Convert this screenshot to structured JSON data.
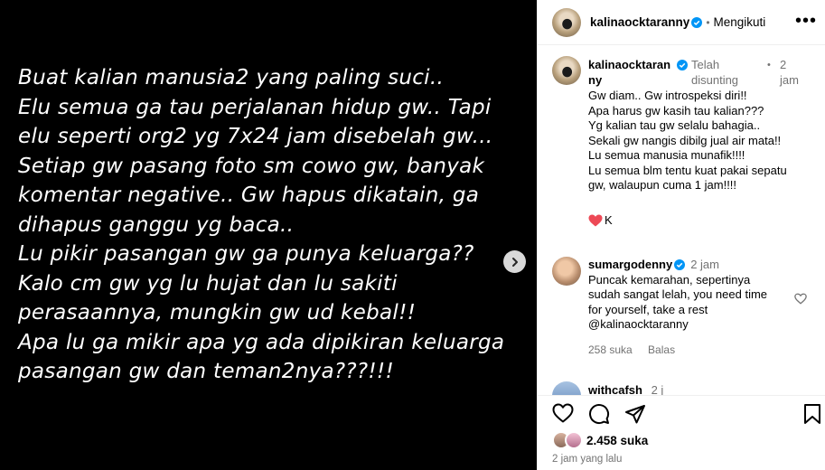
{
  "media": {
    "lines": [
      "Buat kalian manusia2 yang paling suci..",
      "Elu semua ga tau perjalanan hidup gw.. Tapi",
      "elu seperti org2 yg 7x24 jam disebelah gw...",
      "Setiap gw pasang foto sm cowo gw, banyak",
      "komentar negative.. Gw hapus dikatain, ga",
      "dihapus ganggu yg baca..",
      "Lu pikir pasangan gw ga punya keluarga??",
      "Kalo cm gw yg lu hujat dan lu sakiti",
      "perasaannya, mungkin gw ud kebal!!",
      "Apa lu ga mikir apa yg ada dipikiran keluarga",
      "pasangan gw dan teman2nya???!!!"
    ]
  },
  "header": {
    "username": "kalinaocktaranny",
    "separator": "•",
    "follow_label": "Mengikuti",
    "more_icon": "more-icon"
  },
  "caption": {
    "username_line1": "kalinaocktaran",
    "username_line2": "ny",
    "edited_line1": "Telah",
    "edited_line2": "disunting",
    "separator": "•",
    "time_line1": "2",
    "time_line2": "jam",
    "lines": [
      "Gw diam.. Gw introspeksi diri!!",
      "Apa harus gw kasih tau kalian???",
      "Yg kalian tau gw selalu bahagia..",
      "Sekali gw nangis dibilg jual air mata!!",
      "Lu semua manusia munafik!!!!",
      "Lu semua blm tentu kuat pakai sepatu",
      "gw, walaupun cuma 1 jam!!!!"
    ],
    "signature": "K"
  },
  "reply": {
    "username": "sumargodenny",
    "time": "2 jam",
    "lines": [
      "Puncak kemarahan, sepertinya",
      "sudah sangat lelah, you need time",
      "for yourself, take a rest",
      "@kalinaocktaranny"
    ],
    "likes": "258 suka",
    "reply_label": "Balas"
  },
  "next_comment": {
    "username_partial": "withcafsh",
    "time_partial": "2 j"
  },
  "footer": {
    "likes_count": "2.458 suka",
    "time_ago": "2 jam yang lalu"
  },
  "colors": {
    "verified": "#0095f6",
    "heart": "#ed4956",
    "muted": "#737373"
  }
}
